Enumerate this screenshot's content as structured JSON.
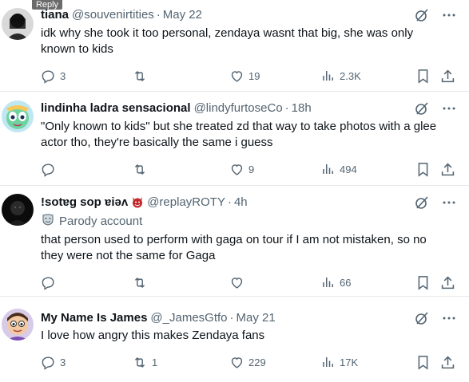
{
  "reply_label": "Reply",
  "tweets": [
    {
      "name": "tiana",
      "handle": "@souvenirtities",
      "time": "May 22",
      "text_lines": [
        "idk why she took it too personal, zendaya wasnt that big, she was only",
        "known to kids"
      ],
      "replies": "3",
      "retweets": "",
      "likes": "19",
      "views": "2.3K"
    },
    {
      "name": "lindinha ladra sensacional",
      "handle": "@lindyfurtoseCo",
      "time": "18h",
      "text_lines": [
        "\"Only known to kids\" but she treated zd that way to take photos with a glee",
        "actor tho, they're basically the same i guess"
      ],
      "replies": "",
      "retweets": "",
      "likes": "9",
      "views": "494"
    },
    {
      "name": "!sotɐg sop ɐiǝʌ",
      "handle": "@replayROTY",
      "time": "4h",
      "parody": "Parody account",
      "text_lines": [
        "that person used to perform with gaga on tour if I am not mistaken, so no",
        "they were not the same for Gaga"
      ],
      "replies": "",
      "retweets": "",
      "likes": "",
      "views": "66"
    },
    {
      "name": "My Name Is James",
      "handle": "@_JamesGtfo",
      "time": "May 21",
      "text_lines": [
        "I love how angry this makes Zendaya fans"
      ],
      "replies": "3",
      "retweets": "1",
      "likes": "229",
      "views": "17K"
    }
  ],
  "separator": "·",
  "icons": {
    "grok": "grok-icon",
    "more": "more-icon",
    "reply": "reply-icon",
    "retweet": "retweet-icon",
    "like": "like-icon",
    "views": "views-icon",
    "bookmark": "bookmark-icon",
    "share": "share-icon",
    "parody": "parody-icon"
  }
}
